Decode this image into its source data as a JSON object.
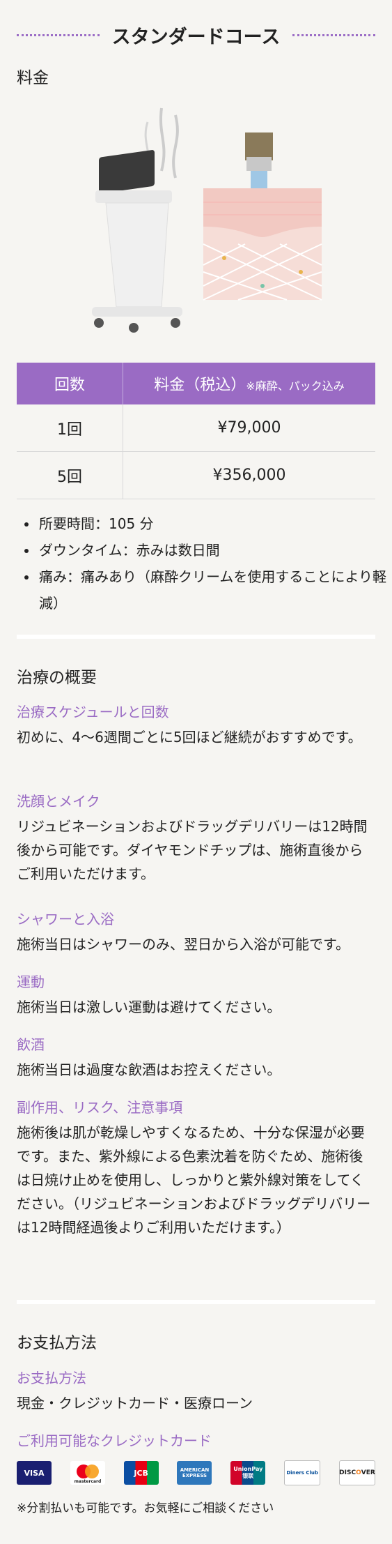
{
  "course": {
    "title": "スタンダードコース"
  },
  "price_section": {
    "title": "料金"
  },
  "price_table": {
    "headers": {
      "count": "回数",
      "price": "料金（税込）",
      "price_note": "※麻酔、パック込み"
    },
    "rows": [
      {
        "count": "1回",
        "price": "¥79,000"
      },
      {
        "count": "5回",
        "price": "¥356,000"
      }
    ]
  },
  "info": [
    "所要時間：105 分",
    "ダウンタイム：赤みは数日間",
    "痛み：痛みあり（麻酔クリームを使用することにより軽減）"
  ],
  "treatment": {
    "title": "治療の概要",
    "items": [
      {
        "heading": "治療スケジュールと回数",
        "body": "初めに、4〜6週間ごとに5回ほど継続がおすすめです。"
      },
      {
        "heading": "洗顔とメイク",
        "body": "リジュビネーションおよびドラッグデリバリーは12時間後から可能です。ダイヤモンドチップは、施術直後からご利用いただけます。"
      },
      {
        "heading": "シャワーと入浴",
        "body": "施術当日はシャワーのみ、翌日から入浴が可能です。"
      },
      {
        "heading": "運動",
        "body": "施術当日は激しい運動は避けてください。"
      },
      {
        "heading": "飲酒",
        "body": "施術当日は過度な飲酒はお控えください。"
      },
      {
        "heading": "副作用、リスク、注意事項",
        "body": "施術後は肌が乾燥しやすくなるため、十分な保湿が必要です。また、紫外線による色素沈着を防ぐため、施術後は日焼け止めを使用し、しっかりと紫外線対策をしてください。（リジュビネーションおよびドラッグデリバリーは12時間経過後よりご利用いただけます。）"
      }
    ]
  },
  "payment": {
    "title": "お支払方法",
    "method_heading": "お支払方法",
    "methods": "現金・クレジットカード・医療ローン",
    "cards_heading": "ご利用可能なクレジットカード",
    "cards": [
      {
        "name": "VISA",
        "color": "#1a1f71"
      },
      {
        "name": "mastercard",
        "color": "#eb001b"
      },
      {
        "name": "JCB",
        "color": "#0b4ea2"
      },
      {
        "name": "AMERICAN EXPRESS",
        "color": "#2e77bb"
      },
      {
        "name": "UnionPay 银联",
        "color": "#d10429"
      },
      {
        "name": "Diners Club",
        "color": "#004a97"
      },
      {
        "name": "DISCOVER",
        "color": "#f58220"
      }
    ],
    "note": "※分割払いも可能です。お気軽にご相談ください"
  },
  "colors": {
    "accent": "#9a6bc4",
    "background": "#f6f5f2"
  }
}
